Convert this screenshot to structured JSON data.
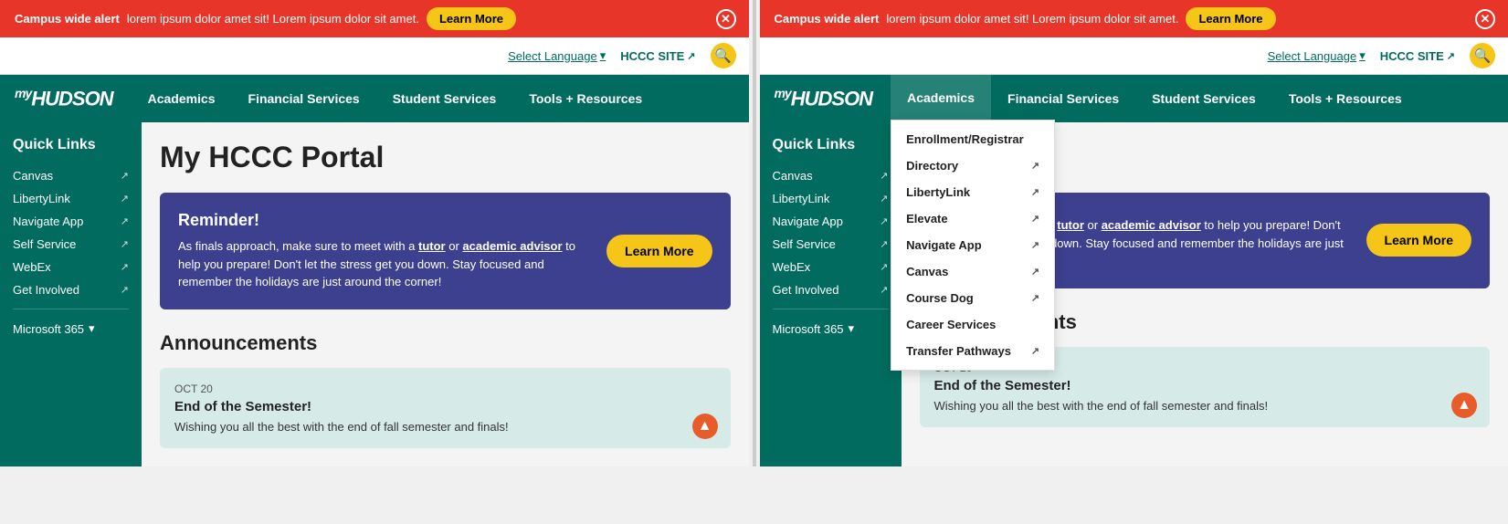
{
  "alert": {
    "bold": "Campus wide alert",
    "text": " lorem ipsum dolor amet sit! Lorem ipsum dolor sit amet.",
    "learn_more": "Learn More",
    "close_aria": "close"
  },
  "utility": {
    "language": "Select Language",
    "hccc_site": "HCCC SITE",
    "search_aria": "search"
  },
  "nav": {
    "logo": "myHUDSON",
    "items": [
      "Academics",
      "Financial Services",
      "Student Services",
      "Tools + Resources"
    ]
  },
  "sidebar": {
    "title": "Quick Links",
    "items": [
      {
        "label": "Canvas",
        "ext": true
      },
      {
        "label": "LibertyLink",
        "ext": true
      },
      {
        "label": "Navigate App",
        "ext": true
      },
      {
        "label": "Self Service",
        "ext": true
      },
      {
        "label": "WebEx",
        "ext": true
      },
      {
        "label": "Get Involved",
        "ext": true
      }
    ],
    "ms365": "Microsoft 365"
  },
  "main": {
    "page_title": "My HCCC Portal",
    "reminder": {
      "title": "Reminder!",
      "body_prefix": "As finals approach, make sure to meet with a ",
      "tutor": "tutor",
      "body_mid": " or ",
      "advisor": "academic advisor",
      "body_suffix": " to help you prepare! Don't let the stress get you down. Stay focused and remember the holidays are just around the corner!",
      "learn_more": "Learn More"
    },
    "announcements_title": "Announcements",
    "announcement": {
      "date": "OCT 20",
      "title": "End of the Semester!",
      "body": "Wishing you all the best with the end of fall semester and finals!"
    }
  },
  "academics_dropdown": {
    "items": [
      {
        "label": "Enrollment/Registrar",
        "ext": false
      },
      {
        "label": "Directory",
        "ext": true
      },
      {
        "label": "LibertyLink",
        "ext": true
      },
      {
        "label": "Elevate",
        "ext": true
      },
      {
        "label": "Navigate App",
        "ext": true
      },
      {
        "label": "Canvas",
        "ext": true
      },
      {
        "label": "Course Dog",
        "ext": true
      },
      {
        "label": "Career Services",
        "ext": false
      },
      {
        "label": "Transfer Pathways",
        "ext": true
      }
    ]
  },
  "panel2": {
    "sidebar": {
      "title": "Quick Links",
      "items": [
        {
          "label": "Canvas",
          "ext": true
        },
        {
          "label": "LibertyLink",
          "ext": true
        },
        {
          "label": "Navigate App",
          "ext": true
        },
        {
          "label": "Self Service",
          "ext": true
        },
        {
          "label": "WebEx",
          "ext": true
        },
        {
          "label": "Get Involved",
          "ext": true
        }
      ],
      "ms365": "Microsoft 365"
    }
  }
}
